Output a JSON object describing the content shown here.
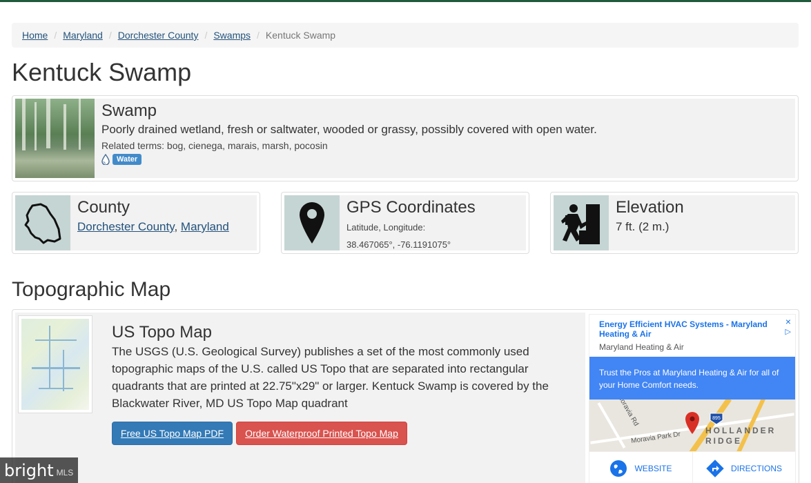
{
  "breadcrumb": [
    {
      "label": "Home"
    },
    {
      "label": "Maryland"
    },
    {
      "label": "Dorchester County"
    },
    {
      "label": "Swamps"
    },
    {
      "label": "Kentuck Swamp"
    }
  ],
  "page_title": "Kentuck Swamp",
  "feature": {
    "title": "Swamp",
    "description": "Poorly drained wetland, fresh or saltwater, wooded or grassy, possibly covered with open water.",
    "related": "Related terms: bog, cienega, marais, marsh, pocosin",
    "tag": "Water",
    "tag_icon": "water-drop-icon"
  },
  "county": {
    "title": "County",
    "county_link": "Dorchester County",
    "separator": ", ",
    "state_link": "Maryland",
    "icon": "county-outline-icon"
  },
  "gps": {
    "title": "GPS Coordinates",
    "label": "Latitude, Longitude:",
    "value": "38.467065°, -76.1191075°",
    "icon": "map-pin-icon"
  },
  "elevation": {
    "title": "Elevation",
    "value": "7 ft. (2 m.)",
    "icon": "hiker-icon"
  },
  "section_title": "Topographic Map",
  "topo": {
    "title": "US Topo Map",
    "description": "The USGS (U.S. Geological Survey) publishes a set of the most commonly used topographic maps of the U.S. called US Topo that are separated into rectangular quadrants that are printed at 22.75\"x29\" or larger. Kentuck Swamp is covered by the Blackwater River, MD US Topo Map quadrant",
    "btn_pdf": "Free US Topo Map PDF",
    "btn_order": "Order Waterproof Printed Topo Map"
  },
  "ad": {
    "title": "Energy Efficient HVAC Systems - Maryland Heating & Air",
    "advertiser": "Maryland Heating & Air",
    "body": "Trust the Pros at Maryland Heating & Air for all of your Home Comfort needs.",
    "map_road1": "Moravia Park Dr",
    "map_road2": "Moravia Rd",
    "map_highway": "895",
    "map_town": "HOLLANDER RIDGE",
    "website": "WEBSITE",
    "directions": "DIRECTIONS",
    "close_icon": "×",
    "info_icon": "▷"
  },
  "watermark": {
    "brand": "bright",
    "suffix": "MLS"
  },
  "colors": {
    "accent_link": "#23527c",
    "btn_blue": "#337ab7",
    "btn_red": "#d9534f",
    "ad_blue": "#4285f4",
    "top_bar": "#1f5a3c"
  }
}
